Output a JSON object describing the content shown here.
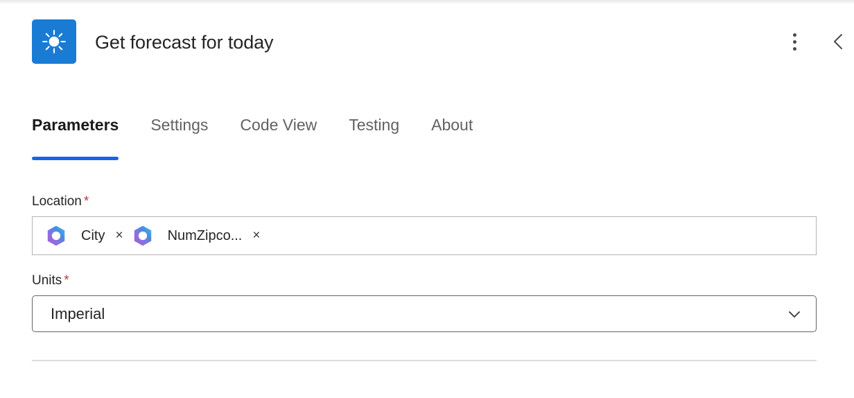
{
  "header": {
    "title": "Get forecast for today",
    "icon_name": "weather-sun-icon",
    "icon_bg": "#1a7bd4",
    "more_menu_label": "More options",
    "collapse_label": "Collapse panel"
  },
  "tabs": [
    {
      "label": "Parameters",
      "active": true
    },
    {
      "label": "Settings",
      "active": false
    },
    {
      "label": "Code View",
      "active": false
    },
    {
      "label": "Testing",
      "active": false
    },
    {
      "label": "About",
      "active": false
    }
  ],
  "tab_accent_color": "#1664e8",
  "form": {
    "location": {
      "label": "Location",
      "required_marker": "*",
      "tokens": [
        {
          "label": "City",
          "icon_name": "copilot-loop-icon",
          "remove_glyph": "×"
        },
        {
          "label": "NumZipco...",
          "icon_name": "copilot-loop-icon",
          "remove_glyph": "×"
        }
      ]
    },
    "units": {
      "label": "Units",
      "required_marker": "*",
      "value": "Imperial",
      "chevron_name": "chevron-down-icon"
    }
  },
  "colors": {
    "required_star": "#b23c3c",
    "text_primary": "#242424",
    "text_secondary": "#616161"
  }
}
